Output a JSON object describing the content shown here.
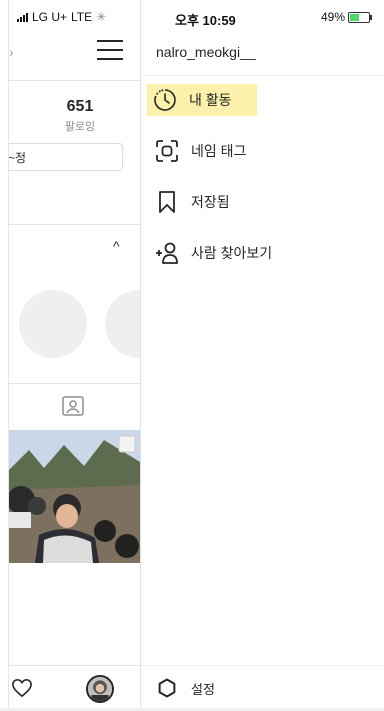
{
  "status": {
    "carrier": "LG U+",
    "network": "LTE",
    "time": "오후 10:59",
    "battery": "49%",
    "battery_color": "#4cd964"
  },
  "profile": {
    "following_count": "651",
    "following_label": "팔로잉",
    "edit_button": "~정"
  },
  "drawer": {
    "username": "nalro_meokgi__",
    "menu": [
      {
        "label": "내 활동",
        "icon": "activity-icon",
        "highlighted": true,
        "highlight_color": "#fbf1ad"
      },
      {
        "label": "네임 태그",
        "icon": "nametag-icon"
      },
      {
        "label": "저장됨",
        "icon": "bookmark-icon"
      },
      {
        "label": "사람 찾아보기",
        "icon": "add-person-icon"
      }
    ],
    "settings_label": "설정"
  }
}
